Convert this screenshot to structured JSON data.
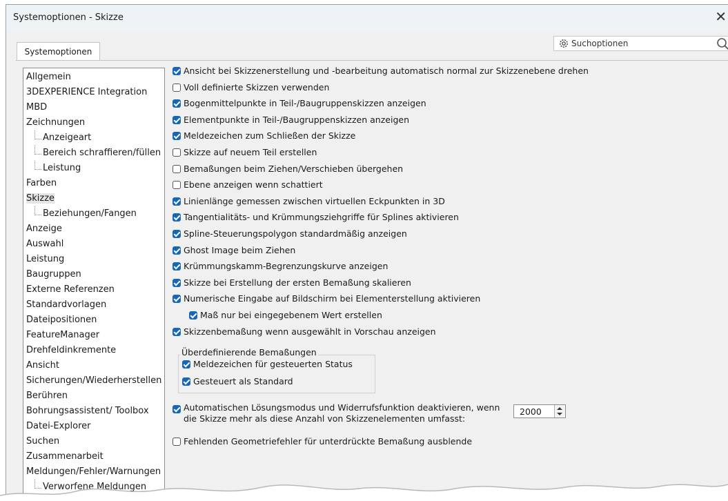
{
  "window": {
    "title": "Systemoptionen - Skizze",
    "close_glyph": "✕"
  },
  "tab": {
    "label": "Systemoptionen"
  },
  "search": {
    "placeholder": "Suchoptionen"
  },
  "tree": {
    "items": [
      {
        "label": "Allgemein",
        "sub": false
      },
      {
        "label": "3DEXPERIENCE Integration",
        "sub": false
      },
      {
        "label": "MBD",
        "sub": false
      },
      {
        "label": "Zeichnungen",
        "sub": false
      },
      {
        "label": "Anzeigeart",
        "sub": true
      },
      {
        "label": "Bereich schraffieren/füllen",
        "sub": true
      },
      {
        "label": "Leistung",
        "sub": true
      },
      {
        "label": "Farben",
        "sub": false
      },
      {
        "label": "Skizze",
        "sub": false,
        "selected": true
      },
      {
        "label": "Beziehungen/Fangen",
        "sub": true
      },
      {
        "label": "Anzeige",
        "sub": false
      },
      {
        "label": "Auswahl",
        "sub": false
      },
      {
        "label": "Leistung",
        "sub": false
      },
      {
        "label": "Baugruppen",
        "sub": false
      },
      {
        "label": "Externe Referenzen",
        "sub": false
      },
      {
        "label": "Standardvorlagen",
        "sub": false
      },
      {
        "label": "Dateipositionen",
        "sub": false
      },
      {
        "label": "FeatureManager",
        "sub": false
      },
      {
        "label": "Drehfeldinkremente",
        "sub": false
      },
      {
        "label": "Ansicht",
        "sub": false
      },
      {
        "label": "Sicherungen/Wiederherstellen",
        "sub": false
      },
      {
        "label": "Berühren",
        "sub": false
      },
      {
        "label": "Bohrungsassistent/ Toolbox",
        "sub": false
      },
      {
        "label": "Datei-Explorer",
        "sub": false
      },
      {
        "label": "Suchen",
        "sub": false
      },
      {
        "label": "Zusammenarbeit",
        "sub": false
      },
      {
        "label": "Meldungen/Fehler/Warnungen",
        "sub": false
      },
      {
        "label": "Verworfene Meldungen",
        "sub": true
      }
    ]
  },
  "options": [
    {
      "label": "Ansicht bei Skizzenerstellung und -bearbeitung automatisch normal zur Skizzenebene drehen",
      "checked": true
    },
    {
      "label": "Voll definierte Skizzen verwenden",
      "checked": false
    },
    {
      "label": "Bogenmittelpunkte in Teil-/Baugruppenskizzen anzeigen",
      "checked": true
    },
    {
      "label": "Elementpunkte in Teil-/Baugruppenskizzen anzeigen",
      "checked": true
    },
    {
      "label": "Meldezeichen zum Schließen der Skizze",
      "checked": true
    },
    {
      "label": "Skizze auf neuem Teil erstellen",
      "checked": false
    },
    {
      "label": "Bemaßungen beim Ziehen/Verschieben übergehen",
      "checked": false
    },
    {
      "label": "Ebene anzeigen wenn schattiert",
      "checked": false
    },
    {
      "label": "Linienlänge gemessen zwischen virtuellen Eckpunkten in 3D",
      "checked": true
    },
    {
      "label": "Tangentialitäts- und Krümmungsziehgriffe für Splines aktivieren",
      "checked": true
    },
    {
      "label": "Spline-Steuerungspolygon standardmäßig anzeigen",
      "checked": true
    },
    {
      "label": "Ghost Image beim Ziehen",
      "checked": true
    },
    {
      "label": "Krümmungskamm-Begrenzungskurve anzeigen",
      "checked": true
    },
    {
      "label": "Skizze bei Erstellung der ersten Bemaßung skalieren",
      "checked": true
    },
    {
      "label": "Numerische Eingabe auf Bildschirm bei Elementerstellung aktivieren",
      "checked": true
    },
    {
      "label": "Maß nur bei eingegebenem Wert erstellen",
      "checked": true,
      "indent": true
    },
    {
      "label": "Skizzenbemaßung wenn ausgewählt in Vorschau anzeigen",
      "checked": true
    }
  ],
  "group": {
    "title": "Überdefinierende Bemaßungen",
    "options": [
      {
        "label": "Meldezeichen für gesteuerten Status",
        "checked": true
      },
      {
        "label": "Gesteuert als Standard",
        "checked": true
      }
    ]
  },
  "auto_solve": {
    "line1": "Automatischen Lösungsmodus und Widerrufsfunktion deaktivieren, wenn",
    "line2": "die Skizze mehr als diese Anzahl von Skizzenelementen umfasst:",
    "checked": true,
    "value": "2000"
  },
  "missing_geom": {
    "label": "Fehlenden Geometriefehler für unterdrückte Bemaßung ausblende",
    "checked": false
  }
}
